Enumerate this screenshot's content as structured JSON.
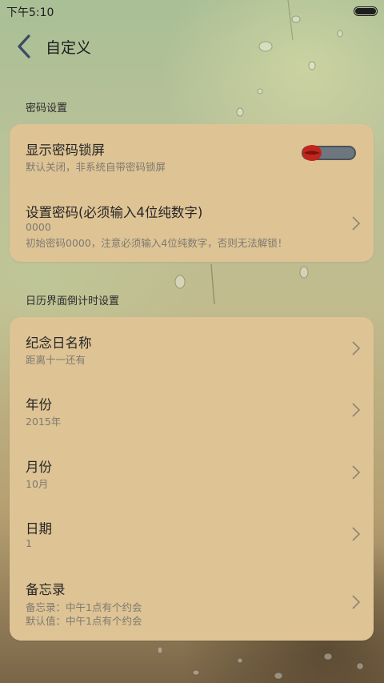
{
  "status_bar": {
    "time": "下午5:10",
    "battery_level": 1.0
  },
  "header": {
    "title": "自定义",
    "back_icon": "chevron-left-icon"
  },
  "sections": {
    "password": {
      "label": "密码设置",
      "items": [
        {
          "title": "显示密码锁屏",
          "subtitle": "默认关闭，非系统自带密码锁屏",
          "control": "toggle",
          "toggle_on": false
        },
        {
          "title": "设置密码(必须输入4位纯数字)",
          "value": "0000",
          "subtitle": "初始密码0000，注意必须输入4位纯数字，否则无法解锁！",
          "control": "chevron"
        }
      ]
    },
    "countdown": {
      "label": "日历界面倒计时设置",
      "items": [
        {
          "title": "纪念日名称",
          "subtitle": "距离十一还有"
        },
        {
          "title": "年份",
          "subtitle": "2015年"
        },
        {
          "title": "月份",
          "subtitle": "10月"
        },
        {
          "title": "日期",
          "subtitle": "1"
        },
        {
          "title": "备忘录",
          "subtitle": "备忘录：中午1点有个约会",
          "subtitle2": "默认值：中午1点有个约会"
        }
      ]
    }
  },
  "colors": {
    "card": "#dec394",
    "accent_toggle_knob": "#c0261d",
    "toggle_track": "#6e7780"
  }
}
